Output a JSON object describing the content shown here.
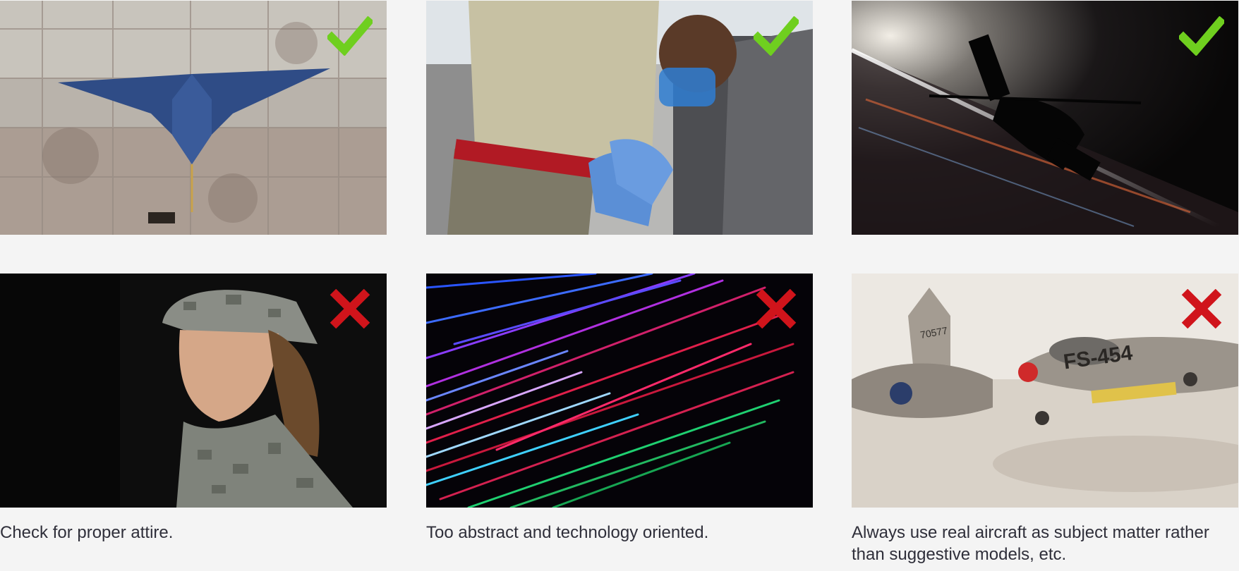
{
  "examples": [
    {
      "subject": "stealth-bomber-on-tarmac",
      "verdict": "approved",
      "verdict_icon": "checkmark-icon",
      "color": "#6fcf1f"
    },
    {
      "subject": "airman-working-with-goggles",
      "verdict": "approved",
      "verdict_icon": "checkmark-icon",
      "color": "#6fcf1f"
    },
    {
      "subject": "helicopter-silhouette-night",
      "verdict": "approved",
      "verdict_icon": "checkmark-icon",
      "color": "#6fcf1f"
    },
    {
      "subject": "soldier-portrait-camouflage",
      "verdict": "rejected",
      "verdict_icon": "x-mark-icon",
      "color": "#d0141b"
    },
    {
      "subject": "abstract-light-streaks",
      "verdict": "rejected",
      "verdict_icon": "x-mark-icon",
      "color": "#d0141b"
    },
    {
      "subject": "model-aircraft",
      "verdict": "rejected",
      "verdict_icon": "x-mark-icon",
      "color": "#d0141b"
    }
  ],
  "captions": [
    "Check for proper attire.",
    "Too abstract and technology oriented.",
    "Always use real aircraft as subject matter rather than suggestive models, etc."
  ],
  "model_aircraft": {
    "tail_number": "70577",
    "nose_marking": "FS-454"
  }
}
